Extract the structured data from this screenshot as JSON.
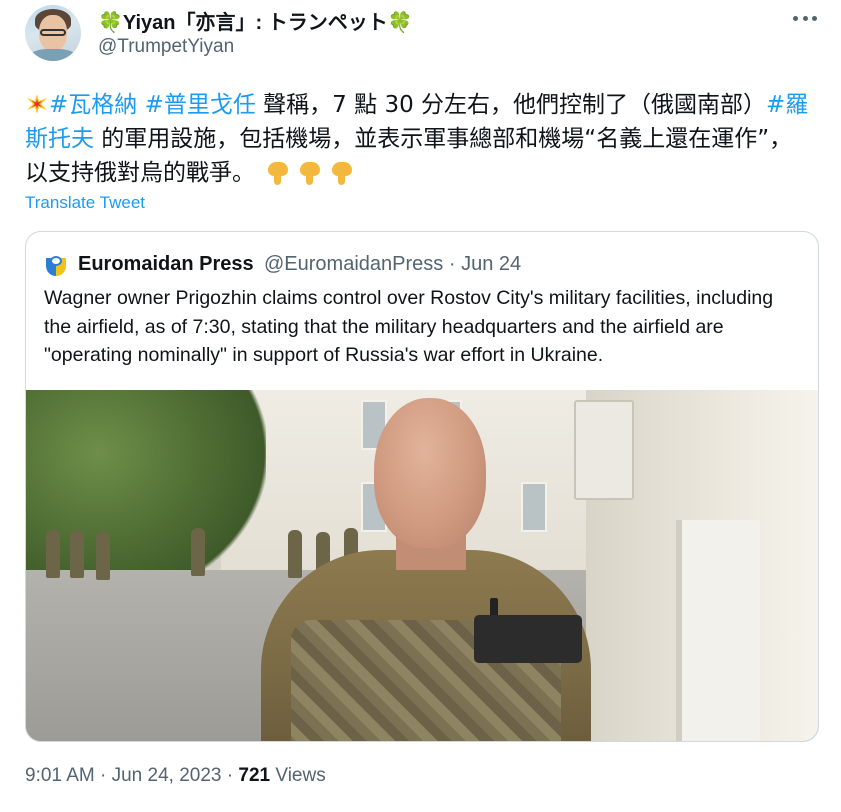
{
  "author": {
    "name_prefix_icon": "four-leaf-clover",
    "name_prefix": "🍀",
    "name": "Yiyan「亦言」: トランペット",
    "name_suffix": "🍀",
    "handle": "@TrumpetYiyan"
  },
  "tweet": {
    "emoji_lead": "collision-emoji",
    "hashtag_1": "#瓦格納",
    "hashtag_2": "#普里戈任",
    "text_1": " 聲稱，7 點 30 分左右，他們控制了（俄國南部）",
    "hashtag_3": "#羅斯托夫",
    "text_2": " 的軍用設施，包括機場，並表示軍事總部和機場“名義上還在運作”，以支持俄對烏的戰爭。",
    "emoji_tail": "backhand-index-pointing-down x3",
    "translate_label": "Translate Tweet"
  },
  "quote": {
    "name": "Euromaidan Press",
    "handle": "@EuromaidanPress",
    "separator": "·",
    "date": "Jun 24",
    "text": "Wagner owner Prigozhin claims control over Rostov City's military facilities, including the airfield, as of 7:30, stating that the military headquarters and the airfield are \"operating nominally\" in support of Russia's war effort in Ukraine.",
    "media_name": "video-still"
  },
  "meta": {
    "time": "9:01 AM",
    "separator": "·",
    "date": "Jun 24, 2023",
    "separator2": "·",
    "views_count": "721",
    "views_label": "Views"
  },
  "colors": {
    "link": "#1d9bf0",
    "secondary_text": "#536471",
    "primary_text": "#0f1419",
    "border": "#cfd9de"
  }
}
